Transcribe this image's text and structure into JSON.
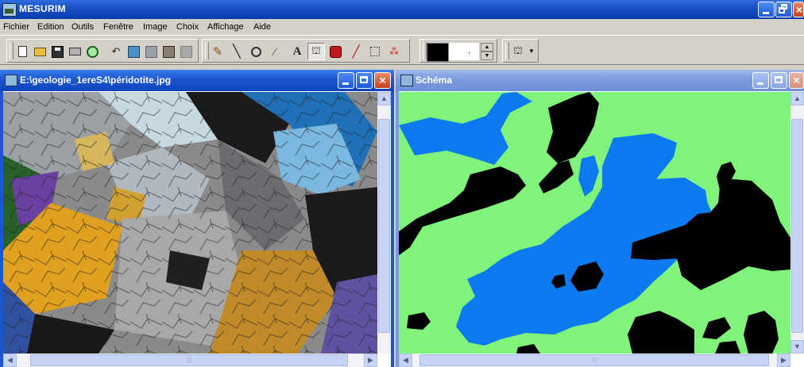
{
  "app": {
    "title": "MESURIM"
  },
  "menu": [
    "Fichier",
    "Edition",
    "Outils",
    "Fenêtre",
    "Image",
    "Choix",
    "Affichage",
    "Aide"
  ],
  "toolbar": {
    "tool_A_label": "A",
    "spin_value": ".",
    "color_swatch": "#000000"
  },
  "windows": {
    "photo": {
      "title": "E:\\geologie_1ereS4\\péridotite.jpg",
      "state": "active"
    },
    "schema": {
      "title": "Schéma",
      "state": "inactive"
    }
  },
  "schema_colors": {
    "background": "#80f47a",
    "blue": "#0c7af0",
    "black": "#000000"
  },
  "scrollbar_grip": "⁞⁞⁞"
}
